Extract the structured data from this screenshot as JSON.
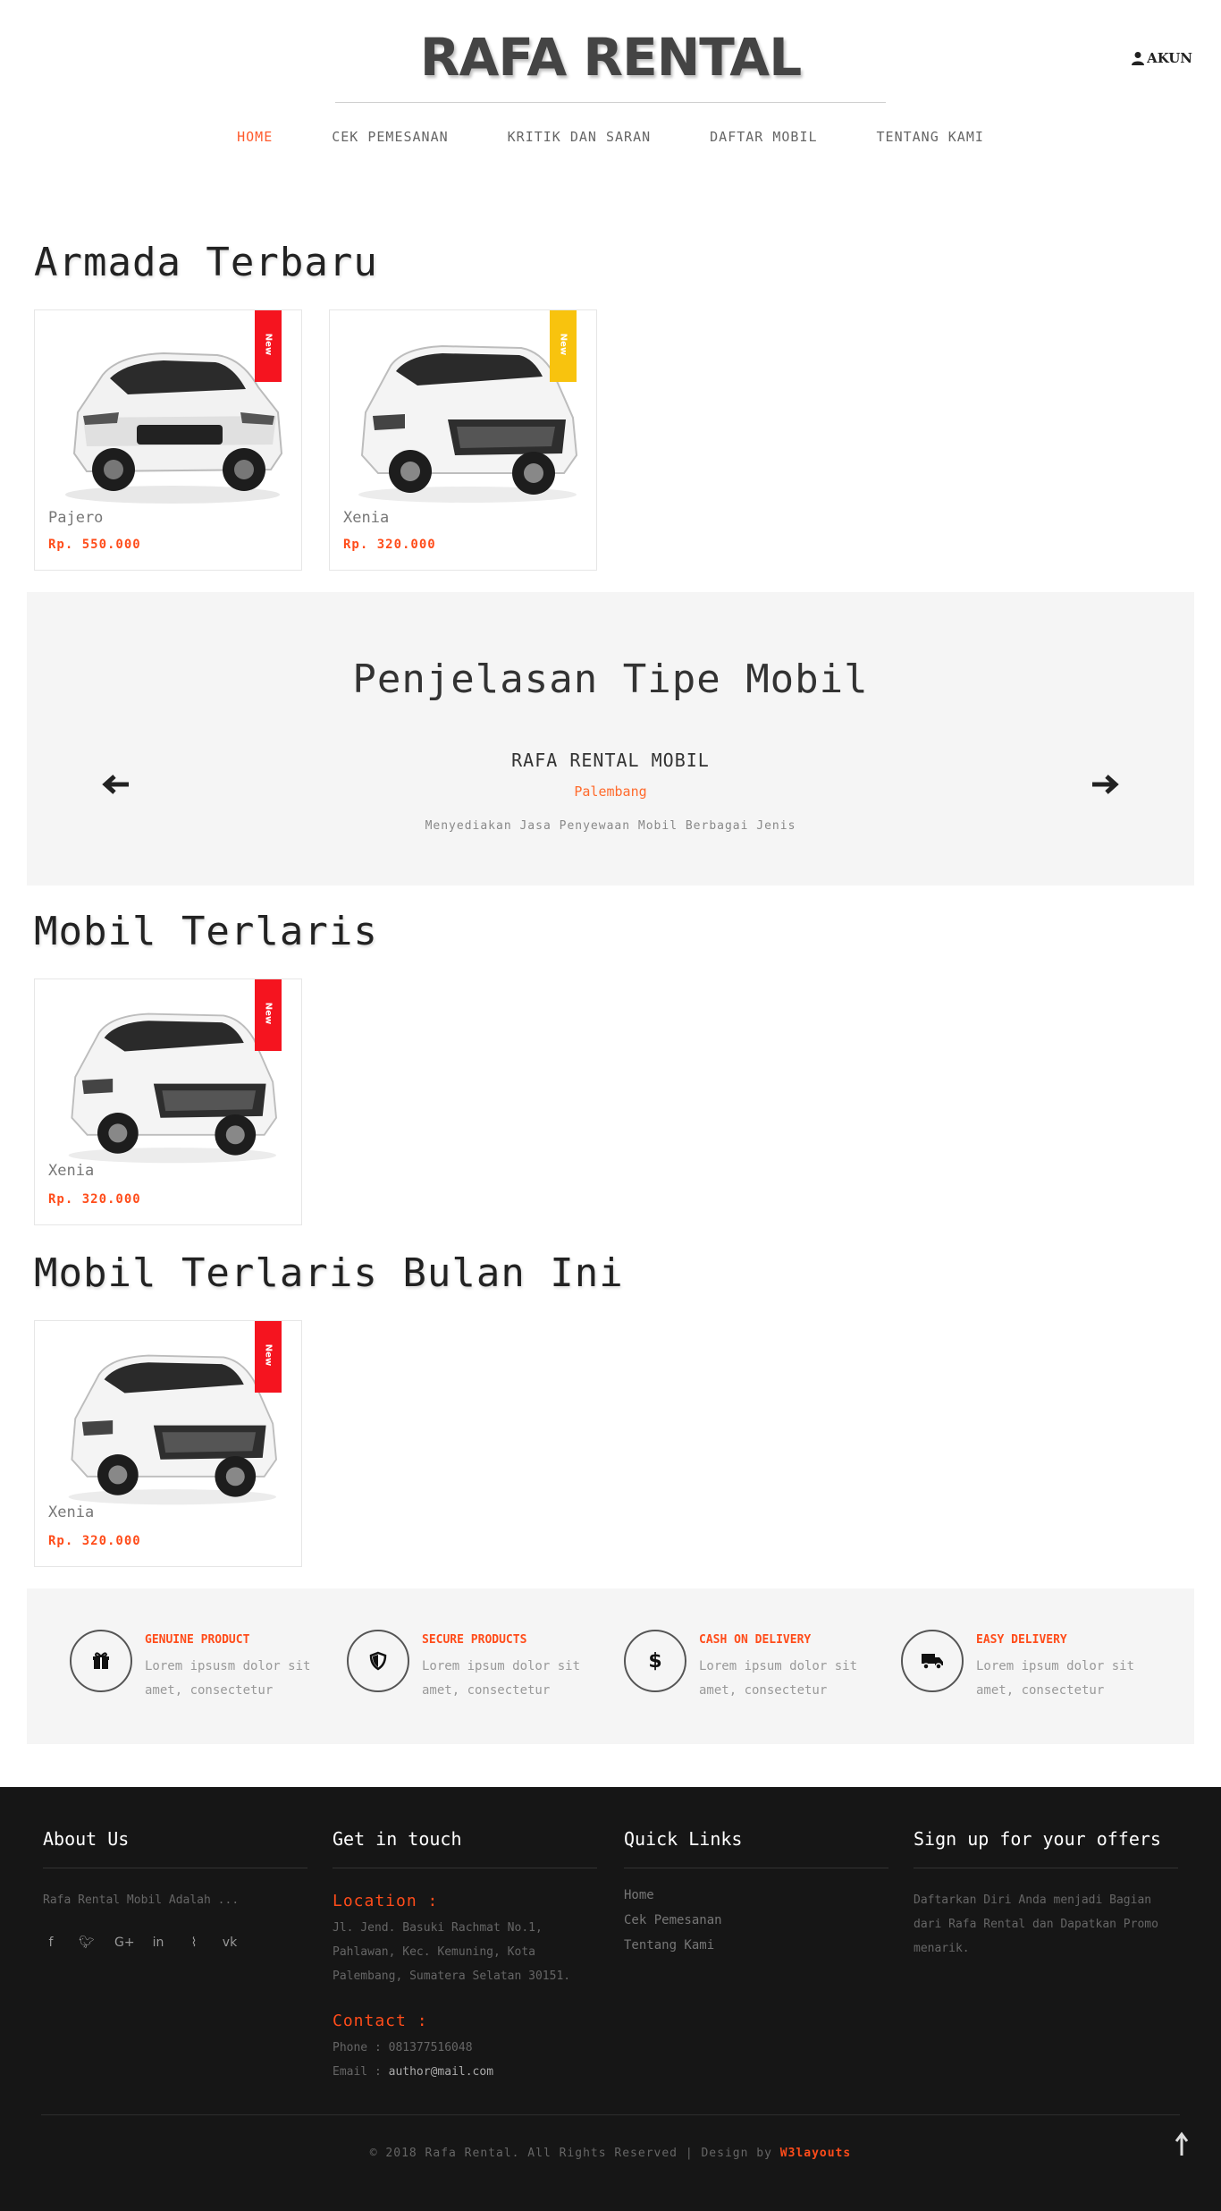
{
  "header": {
    "brand": "RAFA RENTAL",
    "account_label": "AKUN",
    "nav": [
      "HOME",
      "CEK PEMESANAN",
      "KRITIK DAN SARAN",
      "DAFTAR MOBIL",
      "TENTANG KAMI"
    ]
  },
  "armada": {
    "title": "Armada Terbaru",
    "cars": [
      {
        "name": "Pajero",
        "price": "Rp. 550.000",
        "badge": "New",
        "badge_color": "#f5141f"
      },
      {
        "name": "Xenia",
        "price": "Rp. 320.000",
        "badge": "New",
        "badge_color": "#f8c30e"
      }
    ]
  },
  "explain": {
    "title": "Penjelasan Tipe Mobil",
    "name": "RAFA RENTAL MOBIL",
    "location": "Palembang",
    "description": "Menyediakan Jasa Penyewaan Mobil Berbagai Jenis"
  },
  "terlaris": {
    "title": "Mobil Terlaris",
    "cars": [
      {
        "name": "Xenia",
        "price": "Rp. 320.000",
        "badge": "New"
      }
    ]
  },
  "terlaris_bulan": {
    "title": "Mobil Terlaris Bulan Ini",
    "cars": [
      {
        "name": "Xenia",
        "price": "Rp. 320.000",
        "badge": "New"
      }
    ]
  },
  "features": [
    {
      "title": "GENUINE PRODUCT",
      "text": "Lorem ipsusm dolor sit amet, consectetur",
      "icon": "gift-icon"
    },
    {
      "title": "SECURE PRODUCTS",
      "text": "Lorem ipsum dolor sit amet, consectetur",
      "icon": "shield-icon"
    },
    {
      "title": "CASH ON DELIVERY",
      "text": "Lorem ipsum dolor sit amet, consectetur",
      "icon": "dollar-icon"
    },
    {
      "title": "EASY DELIVERY",
      "text": "Lorem ipsum dolor sit amet, consectetur",
      "icon": "truck-icon"
    }
  ],
  "footer": {
    "about": {
      "title": "About Us",
      "text": "Rafa Rental Mobil Adalah ..."
    },
    "contact": {
      "title": "Get in touch",
      "location_label": "Location :",
      "address": "Jl. Jend. Basuki Rachmat No.1, Pahlawan, Kec. Kemuning, Kota Palembang, Sumatera Selatan 30151.",
      "contact_label": "Contact :",
      "phone": "Phone : 081377516048",
      "email_prefix": "Email : ",
      "email": "author@mail.com"
    },
    "links": {
      "title": "Quick Links",
      "items": [
        "Home",
        "Cek Pemesanan",
        "Tentang Kami"
      ]
    },
    "signup": {
      "title": "Sign up for your offers",
      "text": "Daftarkan Diri Anda menjadi Bagian dari Rafa Rental dan Dapatkan Promo menarik."
    },
    "copyright": "© 2018 Rafa Rental. All Rights Reserved | Design by ",
    "designer": "W3layouts"
  },
  "colors": {
    "accent": "#ff4c1a",
    "ribbon_red": "#f5141f",
    "ribbon_yellow": "#f8c30e",
    "footer_bg": "#161616",
    "panel_bg": "#f5f5f5"
  }
}
